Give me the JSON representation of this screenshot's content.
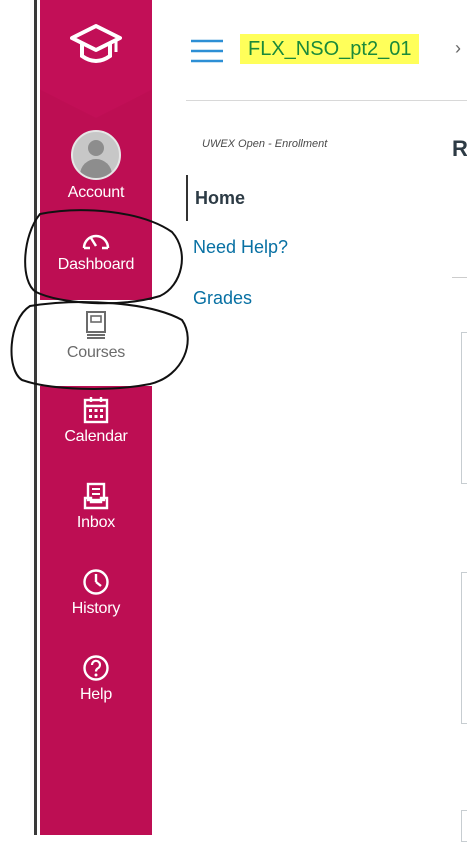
{
  "global_nav": {
    "items": [
      {
        "key": "account",
        "label": "Account"
      },
      {
        "key": "dashboard",
        "label": "Dashboard"
      },
      {
        "key": "courses",
        "label": "Courses"
      },
      {
        "key": "calendar",
        "label": "Calendar"
      },
      {
        "key": "inbox",
        "label": "Inbox"
      },
      {
        "key": "history",
        "label": "History"
      },
      {
        "key": "help",
        "label": "Help"
      }
    ]
  },
  "header": {
    "course_title": "FLX_NSO_pt2_01",
    "breadcrumb_separator": "›"
  },
  "course_nav": {
    "term_label": "UWEX Open - Enrollment",
    "items": [
      {
        "label": "Home",
        "active": true
      },
      {
        "label": "Need Help?",
        "active": false
      },
      {
        "label": "Grades",
        "active": false
      }
    ]
  },
  "main": {
    "heading_fragment": "R"
  },
  "colors": {
    "nav_bg": "#bd0e53",
    "title_highlight": "#ffff5a",
    "link": "#0770a3"
  }
}
